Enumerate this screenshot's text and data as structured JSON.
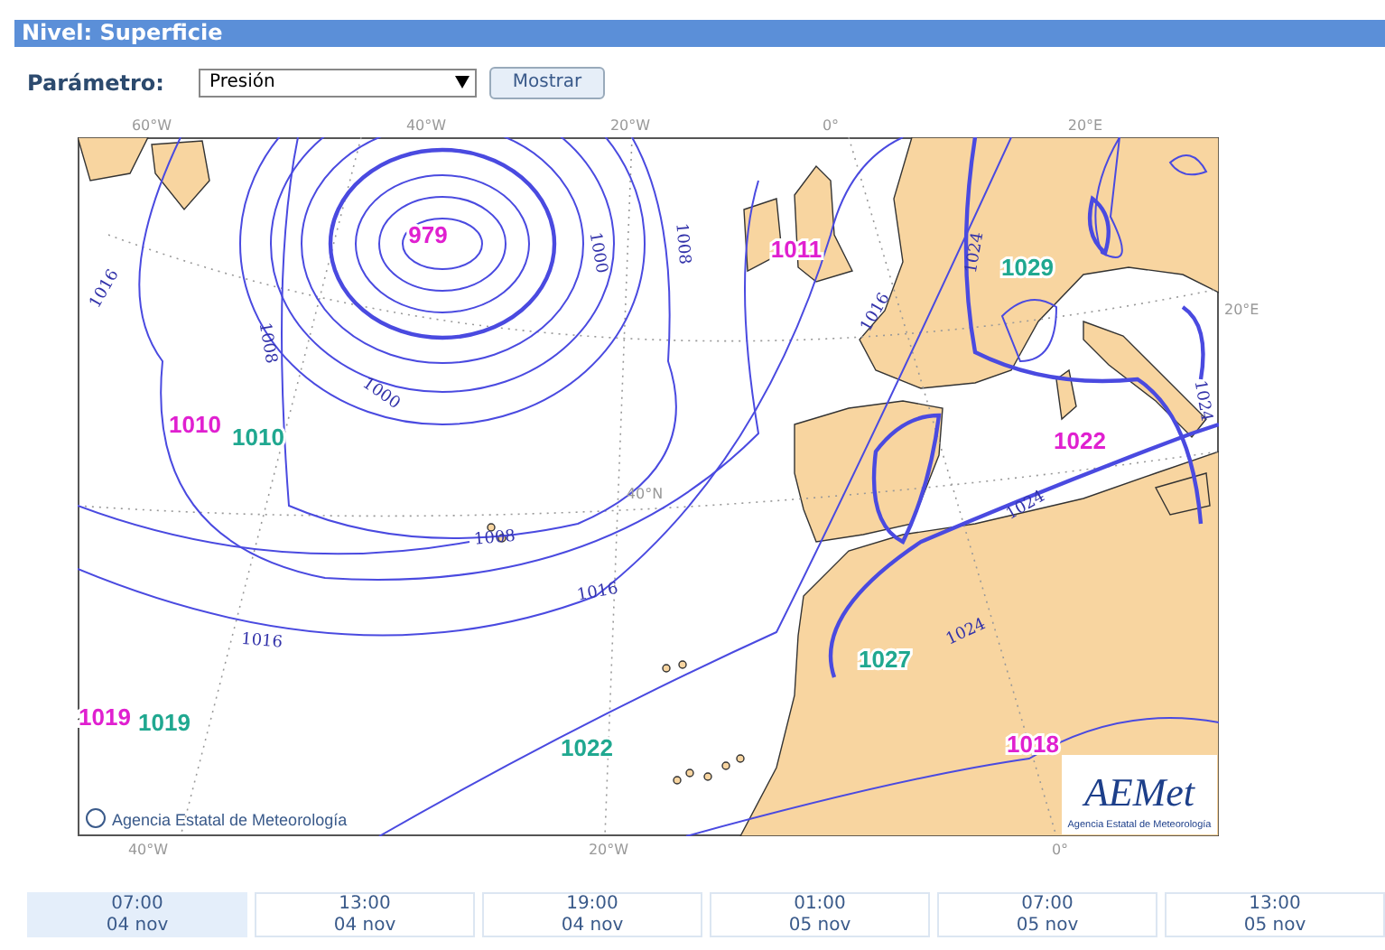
{
  "header": {
    "title": "Nivel: Superficie"
  },
  "parameter": {
    "label": "Parámetro:",
    "value": "Presión",
    "button": "Mostrar"
  },
  "map": {
    "top_longitudes": [
      "60°W",
      "40°W",
      "20°W",
      "0°",
      "20°E"
    ],
    "right_latitude": "20°E",
    "bottom_longitudes": [
      "40°W",
      "20°W",
      "0°"
    ],
    "inner_latitude": "40°N",
    "pressure_labels": [
      {
        "text": "979",
        "color": "#e020d0"
      },
      {
        "text": "1011",
        "color": "#e020d0"
      },
      {
        "text": "1029",
        "color": "#20a890"
      },
      {
        "text": "1010",
        "color": "#20a890"
      },
      {
        "text": "1010",
        "color": "#e020d0"
      },
      {
        "text": "1022",
        "color": "#e020d0"
      },
      {
        "text": "1027",
        "color": "#20a890"
      },
      {
        "text": "1019",
        "color": "#20a890"
      },
      {
        "text": "1019",
        "color": "#e020d0"
      },
      {
        "text": "1022",
        "color": "#20a890"
      },
      {
        "text": "1018",
        "color": "#e020d0"
      }
    ],
    "isobar_labels": [
      "1016",
      "1008",
      "1000",
      "1000",
      "1008",
      "1016",
      "1024",
      "1024",
      "1008",
      "1016",
      "1016",
      "1024",
      "1024"
    ],
    "copyright": "Agencia Estatal de Meteorología",
    "logo": {
      "name": "AEMet",
      "subtitle": "Agencia Estatal de Meteorología"
    }
  },
  "timeline": [
    {
      "time": "07:00",
      "date": "04 nov",
      "selected": true
    },
    {
      "time": "13:00",
      "date": "04 nov",
      "selected": false
    },
    {
      "time": "19:00",
      "date": "04 nov",
      "selected": false
    },
    {
      "time": "01:00",
      "date": "05 nov",
      "selected": false
    },
    {
      "time": "07:00",
      "date": "05 nov",
      "selected": false
    },
    {
      "time": "13:00",
      "date": "05 nov",
      "selected": false
    }
  ]
}
